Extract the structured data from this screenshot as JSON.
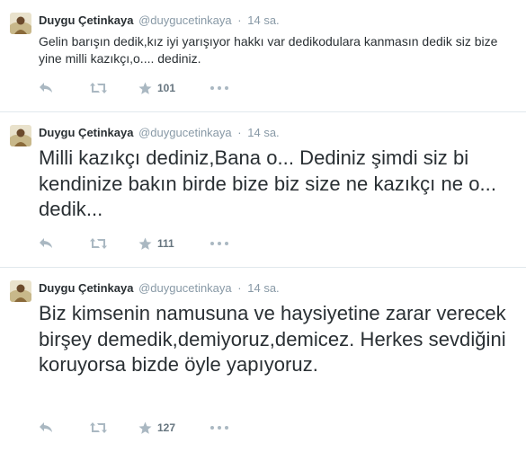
{
  "tweets": [
    {
      "fullname": "Duygu Çetinkaya",
      "username": "@duygucetinkaya",
      "dot": "·",
      "time": "14 sa.",
      "text": "Gelin barışın dedik,kız iyi yarışıyor hakkı var dedikodulara kanmasın dedik siz bize yine milli kazıkçı,o.... dediniz.",
      "favorites": "101"
    },
    {
      "fullname": "Duygu Çetinkaya",
      "username": "@duygucetinkaya",
      "dot": "·",
      "time": "14 sa.",
      "text": "Milli kazıkçı dediniz,Bana o... Dediniz şimdi siz bi kendinize bakın birde bize biz size ne kazıkçı ne o... dedik...",
      "favorites": "111"
    },
    {
      "fullname": "Duygu Çetinkaya",
      "username": "@duygucetinkaya",
      "dot": "·",
      "time": "14 sa.",
      "text": "Biz kimsenin namusuna ve haysiyetine zarar verecek birşey demedik,demiyoruz,demicez. Herkes sevdiğini koruyorsa bizde öyle yapıyoruz.",
      "favorites": "127"
    }
  ],
  "icons": {
    "reply": "reply-arrow-icon",
    "retweet": "retweet-icon",
    "favorite": "star-icon",
    "more": "more-dots-icon"
  },
  "colors": {
    "text": "#292f33",
    "muted": "#8899a6",
    "icon": "#aab8c2",
    "divider": "#e1e8ed"
  }
}
